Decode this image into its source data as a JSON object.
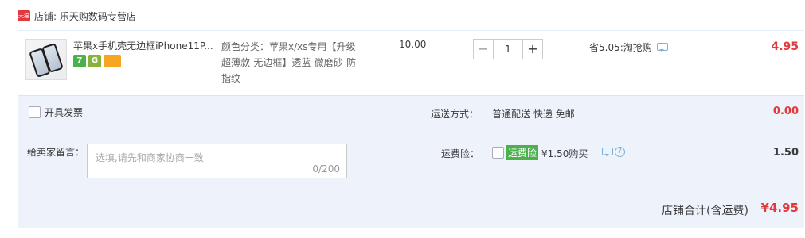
{
  "shop": {
    "badge": "天猫",
    "label": "店铺: 乐天购数码专营店"
  },
  "item": {
    "title": "苹果x手机壳无边框iPhone11P...",
    "sku": "颜色分类：苹果x/xs专用【升级超薄款-无边框】透蓝-微磨砂-防指纹",
    "price": "10.00",
    "quantity": "1",
    "promo": "省5.05:淘抢购",
    "subtotal": "4.95",
    "badges": [
      "7",
      "G",
      ""
    ]
  },
  "invoice": {
    "label": "开具发票"
  },
  "message": {
    "label": "给卖家留言：",
    "placeholder": "选填,请先和商家协商一致",
    "count": "0/200"
  },
  "shipping": {
    "label": "运送方式：",
    "value": "普通配送 快递 免邮",
    "price": "0.00"
  },
  "insurance": {
    "label": "运费险：",
    "tag": "运费险",
    "text": "¥1.50购买",
    "price": "1.50"
  },
  "total": {
    "label": "店铺合计(含运费)",
    "value": "¥4.95"
  },
  "icons": {
    "chat": "chat-icon",
    "help": "help-icon",
    "tmall": "tmall-icon"
  },
  "colors": {
    "accent": "#e4393c",
    "panel": "#eef3fb",
    "green": "#4cb04c"
  }
}
